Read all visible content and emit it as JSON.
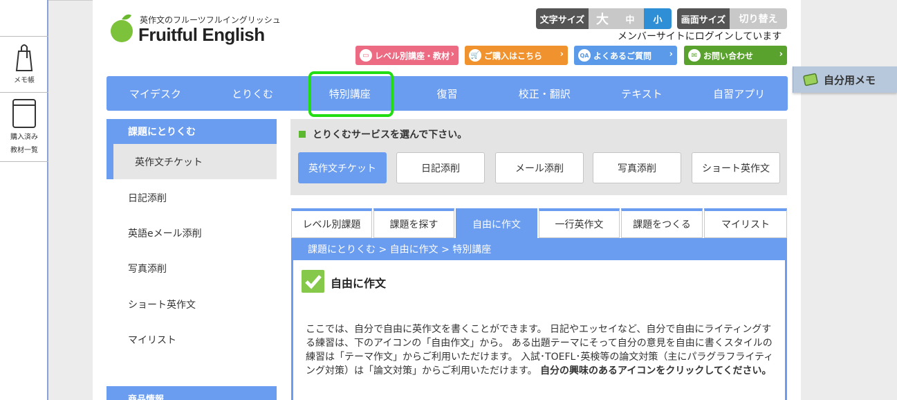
{
  "tools": {
    "memo_label": "メモ帳",
    "books_label_1": "購入済み",
    "books_label_2": "教材一覧"
  },
  "logo": {
    "subtitle": "英作文のフルーツフルイングリッシュ",
    "title": "Fruitful English"
  },
  "text_size": {
    "label": "文字サイズ",
    "large": "大",
    "medium": "中",
    "small": "小"
  },
  "screen_size": {
    "label": "画面サイズ",
    "toggle": "切り替え"
  },
  "login_note": "メンバーサイトにログインしています",
  "header_buttons": {
    "level": "レベル別講座・教材",
    "purchase": "ご購入はこちら",
    "faq": "よくあるご質問",
    "contact": "お問い合わせ"
  },
  "memo_tab": "自分用メモ",
  "nav": [
    "マイデスク",
    "とりくむ",
    "特別講座",
    "復習",
    "校正・翻訳",
    "テキスト",
    "自習アプリ"
  ],
  "sidebar": {
    "header": "課題にとりくむ",
    "selected": "英作文チケット",
    "items": [
      "日記添削",
      "英語eメール添削",
      "写真添削",
      "ショート英作文",
      "マイリスト"
    ],
    "header2": "商品情報"
  },
  "service": {
    "title": "とりくむサービスを選んで下さい。",
    "buttons": [
      "英作文チケット",
      "日記添削",
      "メール添削",
      "写真添削",
      "ショート英作文"
    ]
  },
  "tabs": [
    "レベル別課題",
    "課題を探す",
    "自由に作文",
    "一行英作文",
    "課題をつくる",
    "マイリスト"
  ],
  "breadcrumb": "課題にとりくむ > 自由に作文 > 特別講座",
  "content": {
    "heading": "自由に作文",
    "body": "ここでは、自分で自由に英作文を書くことができます。 日記やエッセイなど、自分で自由にライティングする練習は、下のアイコンの「自由作文」から。 ある出題テーマにそって自分の意見を自由に書くスタイルの練習は「テーマ作文」からご利用いただけます。 入試･TOEFL･英検等の論文対策（主にパラグラフライティング対策）は「論文対策」からご利用いただけます。 ",
    "body_bold": "自分の興味のあるアイコンをクリックしてください。"
  },
  "colors": {
    "accent": "#6a9cf0",
    "highlight": "#22dd11",
    "check": "#86c84a"
  }
}
